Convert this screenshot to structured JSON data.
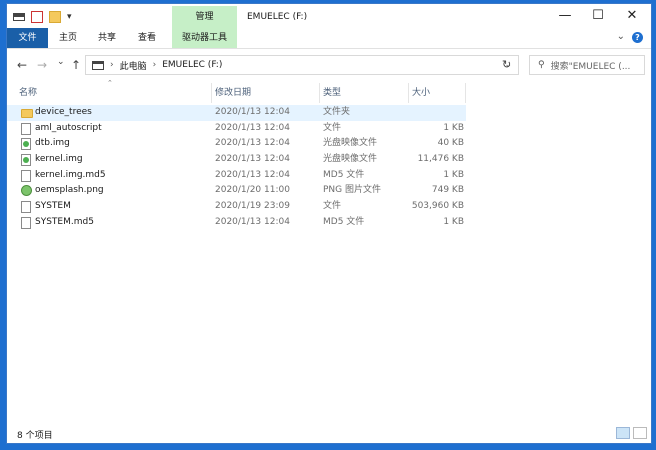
{
  "window": {
    "title": "EMUELEC (F:)",
    "manage_tab": "管理",
    "min_glyph": "—",
    "max_glyph": "☐",
    "close_glyph": "✕"
  },
  "ribbon": {
    "tabs": [
      "文件",
      "主页",
      "共享",
      "查看",
      "驱动器工具"
    ]
  },
  "nav": {
    "back": "←",
    "forward": "→",
    "history": "⌄",
    "up": "↑",
    "path": [
      "此电脑",
      "EMUELEC (F:)"
    ],
    "refresh": "↻",
    "search_placeholder": "搜索\"EMUELEC (..."
  },
  "columns": [
    "名称",
    "修改日期",
    "类型",
    "大小"
  ],
  "files": [
    {
      "name": "device_trees",
      "modified": "2020/1/13 12:04",
      "type": "文件夹",
      "size": "",
      "icon": "folder"
    },
    {
      "name": "aml_autoscript",
      "modified": "2020/1/13 12:04",
      "type": "文件",
      "size": "1 KB",
      "icon": "doc"
    },
    {
      "name": "dtb.img",
      "modified": "2020/1/13 12:04",
      "type": "光盘映像文件",
      "size": "40 KB",
      "icon": "img"
    },
    {
      "name": "kernel.img",
      "modified": "2020/1/13 12:04",
      "type": "光盘映像文件",
      "size": "11,476 KB",
      "icon": "img"
    },
    {
      "name": "kernel.img.md5",
      "modified": "2020/1/13 12:04",
      "type": "MD5 文件",
      "size": "1 KB",
      "icon": "doc"
    },
    {
      "name": "oemsplash.png",
      "modified": "2020/1/20 11:00",
      "type": "PNG 图片文件",
      "size": "749 KB",
      "icon": "png"
    },
    {
      "name": "SYSTEM",
      "modified": "2020/1/19 23:09",
      "type": "文件",
      "size": "503,960 KB",
      "icon": "doc"
    },
    {
      "name": "SYSTEM.md5",
      "modified": "2020/1/13 12:04",
      "type": "MD5 文件",
      "size": "1 KB",
      "icon": "doc"
    }
  ],
  "status": {
    "item_count": "8 个项目"
  },
  "colors": {
    "accent": "#1a5fa8",
    "manage_tab_bg": "#c6efc7",
    "selected_row": "#e5f3ff",
    "desktop": "#1e6fd0"
  }
}
